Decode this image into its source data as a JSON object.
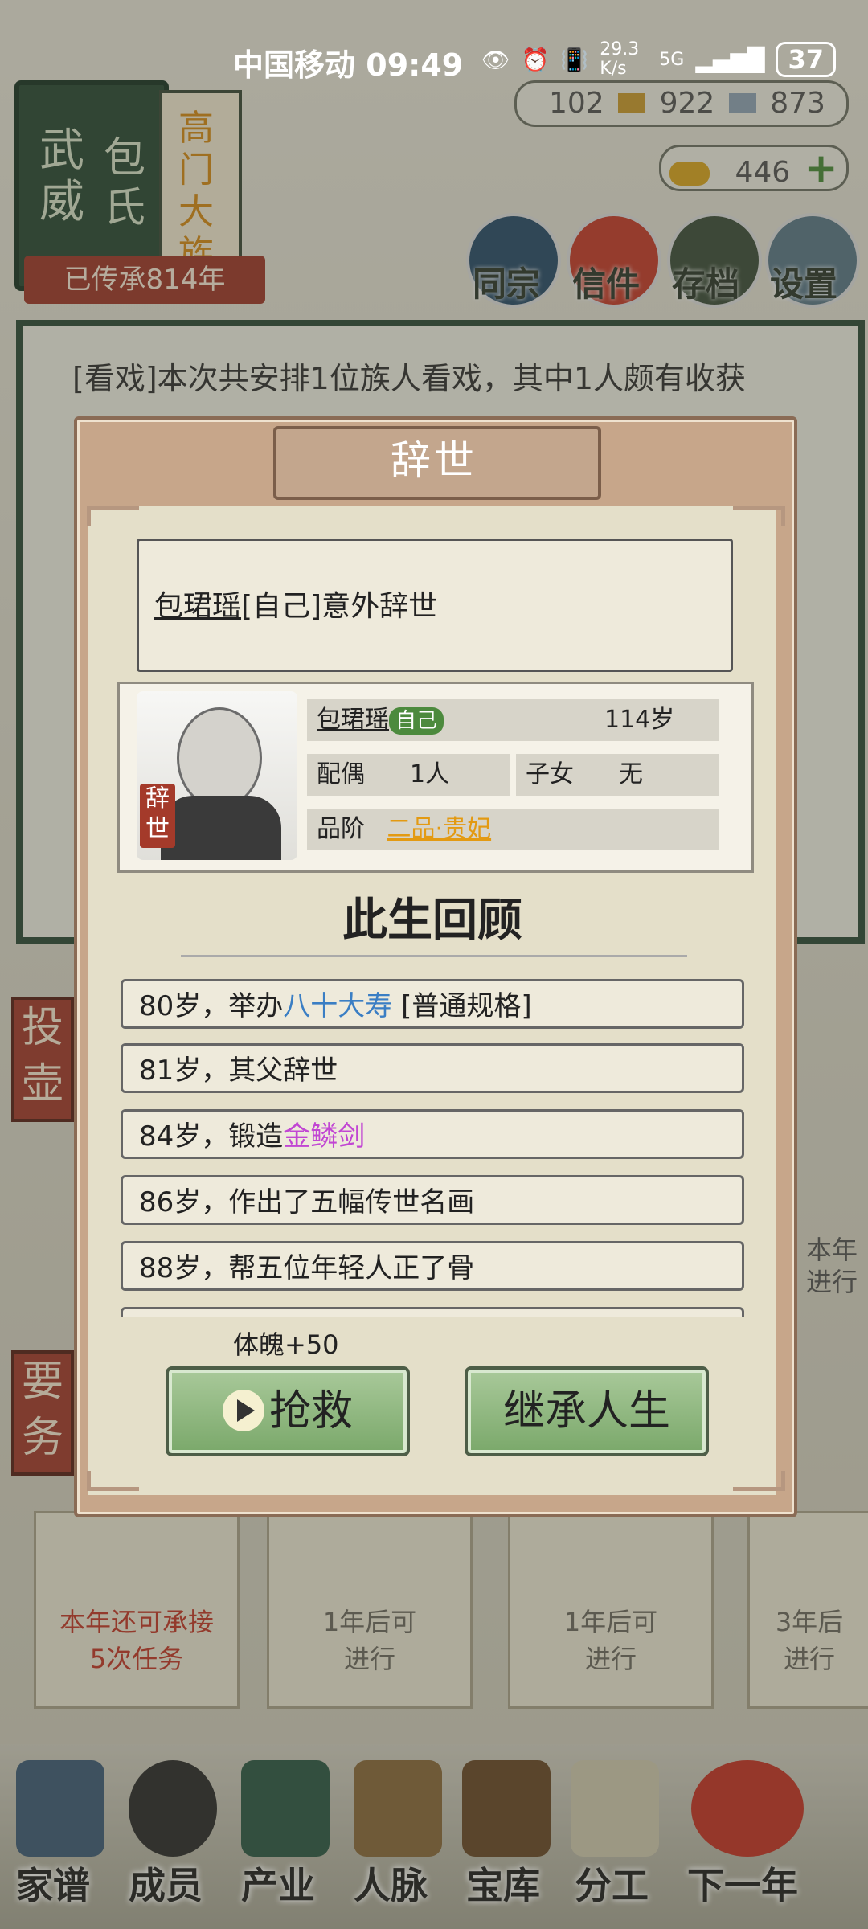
{
  "status_bar": {
    "carrier": "中国移动",
    "time": "09:49",
    "speed": "29.3 K/s",
    "network": "5G",
    "battery": "37"
  },
  "family": {
    "book_title": "武威 包氏",
    "book_title_1": "武威",
    "book_title_2": "包氏",
    "tier": "高门大族",
    "inherit": "已传承814年"
  },
  "resources": {
    "r1": "102",
    "r2": "922",
    "r3": "873",
    "gold": "446"
  },
  "top_menu": [
    "同宗",
    "信件",
    "存档",
    "设置"
  ],
  "log": {
    "line1": "[看戏]本次共安排1位族人看戏，其中1人颇有收获"
  },
  "side_buttons": [
    "投壶",
    "要务"
  ],
  "cards": [
    {
      "line1": "本年还可承接",
      "line2": "5次任务"
    },
    {
      "line1": "1年后可",
      "line2": "进行"
    },
    {
      "line1": "1年后可",
      "line2": "进行"
    },
    {
      "line1": "3年后",
      "line2": "进行"
    }
  ],
  "right_card_partial": {
    "line1": "本年",
    "line2": "进行"
  },
  "bottom_nav": [
    "家谱",
    "成员",
    "产业",
    "人脉",
    "宝库",
    "分工",
    "下一年"
  ],
  "dialog": {
    "title": "辞世",
    "message_name": "包珺瑶",
    "message_rest": "[自己]意外辞世",
    "tag": "辞世",
    "profile": {
      "name": "包珺瑶",
      "self_badge": "自己",
      "age": "114岁",
      "spouse_label": "配偶",
      "spouse_value": "1人",
      "children_label": "子女",
      "children_value": "无",
      "rank_label": "品阶",
      "rank_value": "二品·贵妃"
    },
    "recap_title": "此生回顾",
    "events": [
      {
        "prefix": "80岁，举办",
        "highlight": "八十大寿",
        "suffix": " [普通规格]"
      },
      {
        "prefix": "81岁，其父辞世",
        "highlight": "",
        "suffix": ""
      },
      {
        "prefix": "84岁，锻造",
        "highlight": "金鳞剑",
        "suffix": ""
      },
      {
        "prefix": "86岁，作出了五幅传世名画",
        "highlight": "",
        "suffix": ""
      },
      {
        "prefix": "88岁，帮五位年轻人正了骨",
        "highlight": "",
        "suffix": ""
      }
    ],
    "bonus": "体魄+50",
    "rescue_button": "抢救",
    "inherit_button": "继承人生"
  },
  "colors": {
    "dialog_bg": "#c7a68a",
    "button_green": "#8fb87e",
    "rank_orange": "#e39a12",
    "event_blue": "#3a7ec4",
    "event_purple": "#c146d3"
  }
}
